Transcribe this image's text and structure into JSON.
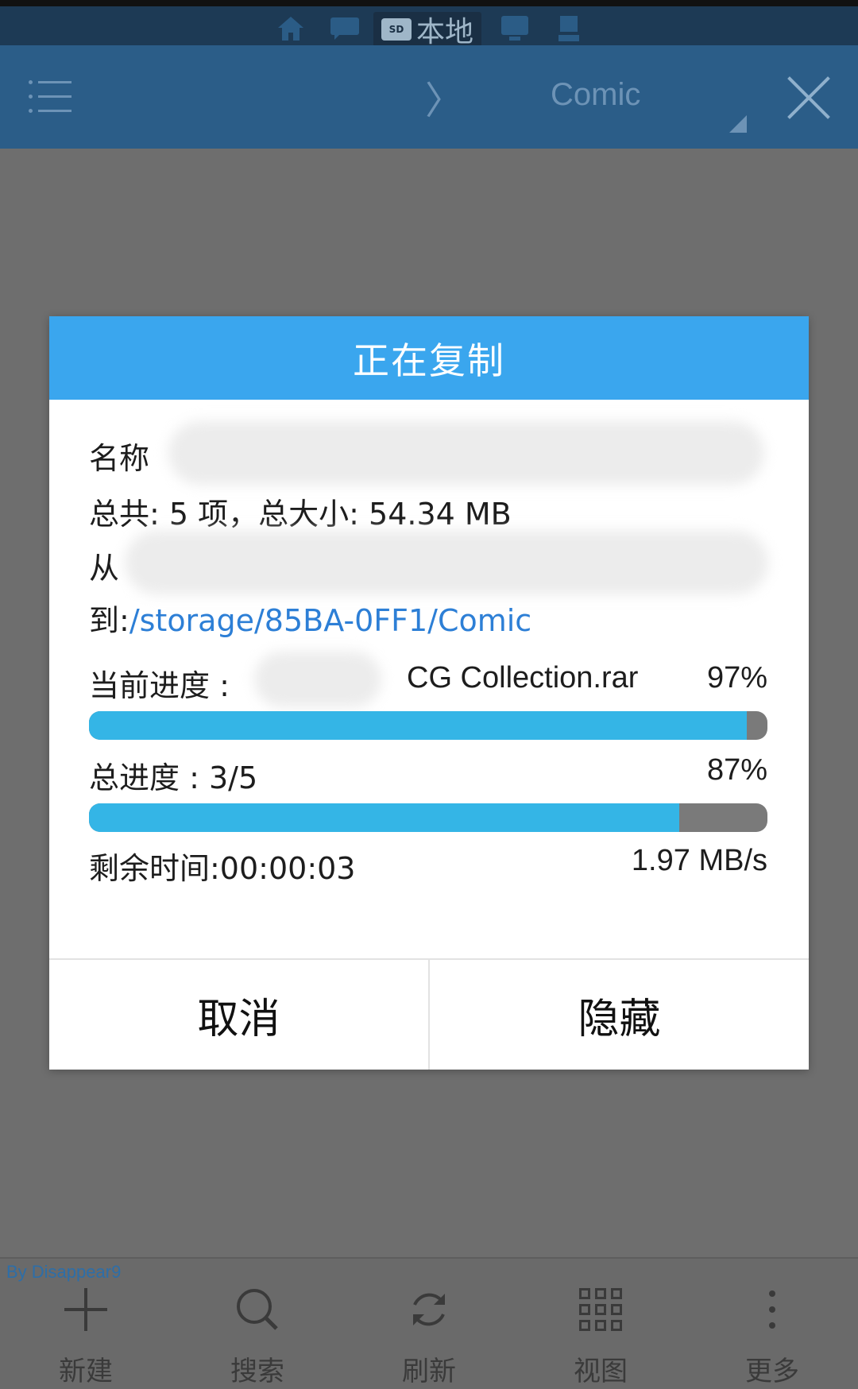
{
  "location_bar": {
    "active_label": "本地",
    "sd_badge": "SD"
  },
  "appbar": {
    "chevron": "〉",
    "title": "Comic"
  },
  "dialog": {
    "title": "正在复制",
    "name_label": "名称",
    "total_line": "总共: 5 项，总大小: 54.34 MB",
    "from_label": "从",
    "to_label": "到:",
    "to_path": "/storage/85BA-0FF1/Comic",
    "current_label": "当前进度 :",
    "current_file": "CG Collection.rar",
    "current_percent": "97%",
    "current_progress": 0.97,
    "total_label": "总进度 : 3/5",
    "total_percent": "87%",
    "total_progress": 0.87,
    "remaining": "剩余时间:00:00:03",
    "speed": "1.97 MB/s",
    "cancel_label": "取消",
    "hide_label": "隐藏"
  },
  "bottombar": {
    "watermark": "By Disappear9",
    "new_label": "新建",
    "search_label": "搜索",
    "refresh_label": "刷新",
    "view_label": "视图",
    "more_label": "更多"
  },
  "colors": {
    "dialog_header": "#3aa6ee",
    "progress_fill": "#34b5e6",
    "progress_track": "#7a7a7a",
    "path_link": "#2d7fd6",
    "appbar": "#2b5d88"
  }
}
